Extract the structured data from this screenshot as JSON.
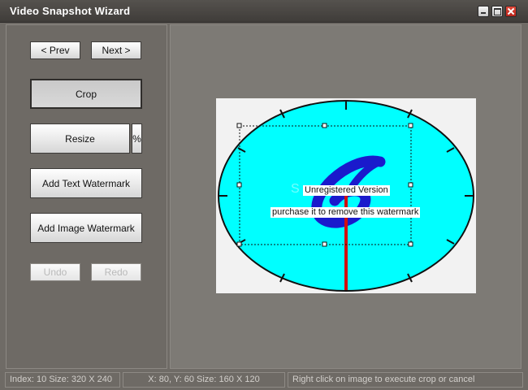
{
  "window": {
    "title": "Video Snapshot Wizard",
    "controls": {
      "minimize": "minimize-icon",
      "maximize": "maximize-icon",
      "close": "close-icon"
    }
  },
  "toolbar": {
    "prev_label": "< Prev",
    "next_label": "Next >",
    "crop_label": "Crop",
    "resize_label": "Resize",
    "percent_label": "%",
    "add_text_watermark_label": "Add Text Watermark",
    "add_image_watermark_label": "Add Image Watermark",
    "undo_label": "Undo",
    "redo_label": "Redo"
  },
  "preview": {
    "watermark_line1": "Unregistered Version",
    "watermark_line2": "purchase it to remove this watermark",
    "colors": {
      "clock_face": "#00ffff",
      "logo": "#1a1acc",
      "hand": "#d01010"
    }
  },
  "status": {
    "index_info": "Index: 10  Size: 320 X 240",
    "selection_info": "X: 80, Y: 60   Size: 160 X 120",
    "hint": "Right click on image to execute crop or cancel"
  }
}
